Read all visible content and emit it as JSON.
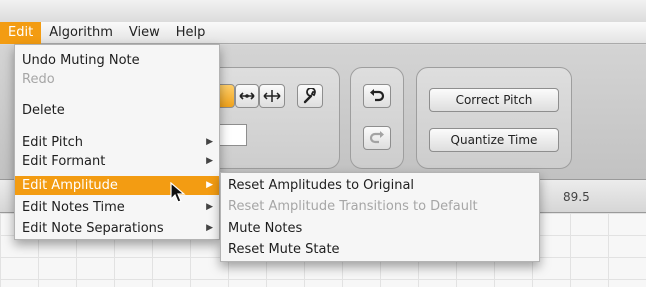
{
  "menubar": {
    "items": [
      "Edit",
      "Algorithm",
      "View",
      "Help"
    ],
    "active_index": 0
  },
  "edit_menu": {
    "items": [
      {
        "label": "Undo Muting Note",
        "enabled": true,
        "submenu": false
      },
      {
        "label": "Redo",
        "enabled": false,
        "submenu": false
      },
      {
        "label": "Delete",
        "enabled": true,
        "submenu": false
      },
      {
        "label": "Edit Pitch",
        "enabled": true,
        "submenu": true
      },
      {
        "label": "Edit Formant",
        "enabled": true,
        "submenu": true
      },
      {
        "label": "Edit Amplitude",
        "enabled": true,
        "submenu": true,
        "highlighted": true
      },
      {
        "label": "Edit Notes Time",
        "enabled": true,
        "submenu": true
      },
      {
        "label": "Edit Note Separations",
        "enabled": true,
        "submenu": true
      }
    ]
  },
  "amplitude_submenu": {
    "items": [
      {
        "label": "Reset Amplitudes to Original",
        "enabled": true
      },
      {
        "label": "Reset Amplitude Transitions to Default",
        "enabled": false
      },
      {
        "label": "Mute Notes",
        "enabled": true
      },
      {
        "label": "Reset Mute State",
        "enabled": true
      }
    ]
  },
  "toolbar": {
    "correct_pitch_label": "Correct Pitch",
    "quantize_time_label": "Quantize Time"
  },
  "ruler": {
    "value_label": "89.5"
  },
  "colors": {
    "accent": "#f39c12",
    "menu_bg": "#f6f6f6",
    "disabled_text": "#a6a6a6"
  },
  "icons": {
    "submenu_arrow": "▶",
    "undo": "undo-icon",
    "redo": "redo-icon",
    "wrench": "wrench-icon"
  }
}
